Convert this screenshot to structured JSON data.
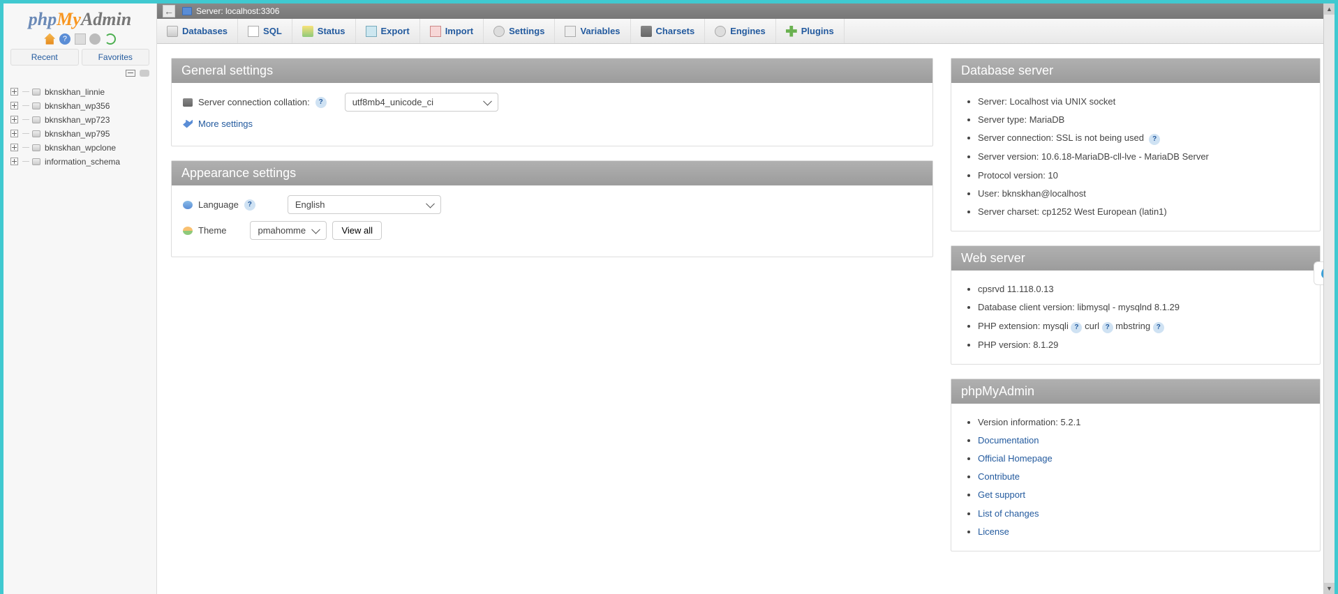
{
  "logo": {
    "p1": "php",
    "p2": "My",
    "p3": "Admin"
  },
  "sidebar": {
    "tabs": {
      "recent": "Recent",
      "favorites": "Favorites"
    },
    "databases": [
      "bknskhan_linnie",
      "bknskhan_wp356",
      "bknskhan_wp723",
      "bknskhan_wp795",
      "bknskhan_wpclone",
      "information_schema"
    ]
  },
  "topbar": {
    "server_label": "Server: localhost:3306"
  },
  "menu": {
    "databases": "Databases",
    "sql": "SQL",
    "status": "Status",
    "export": "Export",
    "import": "Import",
    "settings": "Settings",
    "variables": "Variables",
    "charsets": "Charsets",
    "engines": "Engines",
    "plugins": "Plugins"
  },
  "general": {
    "title": "General settings",
    "collation_label": "Server connection collation:",
    "collation_value": "utf8mb4_unicode_ci",
    "more_settings": "More settings"
  },
  "appearance": {
    "title": "Appearance settings",
    "language_label": "Language",
    "language_value": "English",
    "theme_label": "Theme",
    "theme_value": "pmahomme",
    "view_all": "View all"
  },
  "dbserver": {
    "title": "Database server",
    "items": [
      "Server: Localhost via UNIX socket",
      "Server type: MariaDB",
      "Server connection: SSL is not being used",
      "Server version: 10.6.18-MariaDB-cll-lve - MariaDB Server",
      "Protocol version: 10",
      "User: bknskhan@localhost",
      "Server charset: cp1252 West European (latin1)"
    ]
  },
  "webserver": {
    "title": "Web server",
    "line1": "cpsrvd 11.118.0.13",
    "line2": "Database client version: libmysql - mysqlnd 8.1.29",
    "php_ext_label": "PHP extension:",
    "php_exts": [
      "mysqli",
      "curl",
      "mbstring"
    ],
    "php_version": "PHP version: 8.1.29"
  },
  "pma": {
    "title": "phpMyAdmin",
    "version": "Version information: 5.2.1",
    "links": [
      "Documentation",
      "Official Homepage",
      "Contribute",
      "Get support",
      "List of changes",
      "License"
    ]
  }
}
